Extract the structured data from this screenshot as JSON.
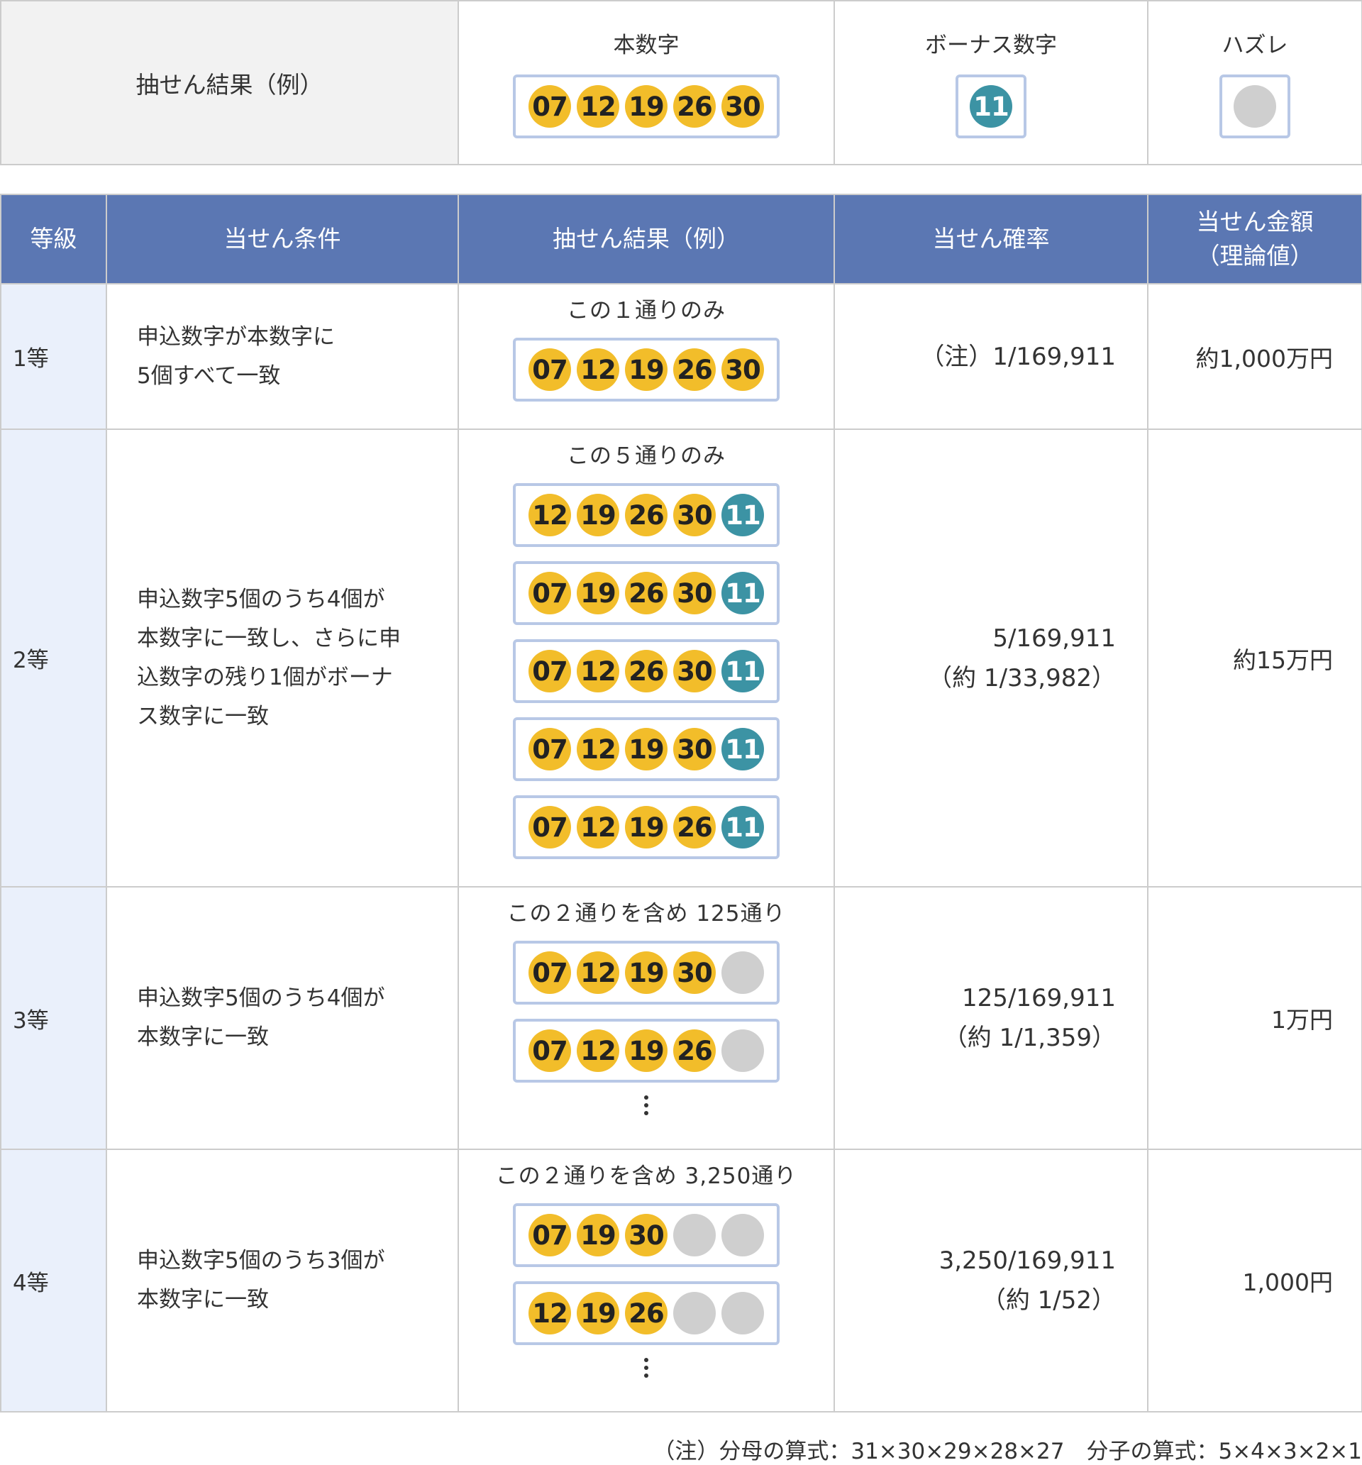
{
  "legend": {
    "label": "抽せん結果（例）",
    "main_head": "本数字",
    "main_balls": [
      "07",
      "12",
      "19",
      "26",
      "30"
    ],
    "bonus_head": "ボーナス数字",
    "bonus_ball": "11",
    "miss_head": "ハズレ"
  },
  "table": {
    "headers": {
      "grade": "等級",
      "condition": "当せん条件",
      "result": "抽せん結果（例）",
      "probability": "当せん確率",
      "amount_line1": "当せん金額",
      "amount_line2": "（理論値）"
    },
    "rows": [
      {
        "grade": "1等",
        "condition_lines": [
          "申込数字が本数字に",
          "5個すべて一致"
        ],
        "note": "この１通りのみ",
        "combos": [
          [
            "07",
            "12",
            "19",
            "26",
            "30"
          ]
        ],
        "prob_line1": "（注）1/169,911",
        "prob_line2": "",
        "amount": "約1,000万円"
      },
      {
        "grade": "2等",
        "condition_lines": [
          "申込数字5個のうち4個が",
          "本数字に一致し、さらに申",
          "込数字の残り1個がボーナ",
          "ス数字に一致"
        ],
        "note": "この５通りのみ",
        "combos": [
          [
            "12",
            "19",
            "26",
            "30",
            "11"
          ],
          [
            "07",
            "19",
            "26",
            "30",
            "11"
          ],
          [
            "07",
            "12",
            "26",
            "30",
            "11"
          ],
          [
            "07",
            "12",
            "19",
            "30",
            "11"
          ],
          [
            "07",
            "12",
            "19",
            "26",
            "11"
          ]
        ],
        "prob_line1": "5/169,911",
        "prob_line2": "（約 1/33,982）",
        "amount": "約15万円"
      },
      {
        "grade": "3等",
        "condition_lines": [
          "申込数字5個のうち4個が",
          "本数字に一致"
        ],
        "note": "この２通りを含め 125通り",
        "combos": [
          [
            "07",
            "12",
            "19",
            "30",
            ""
          ],
          [
            "07",
            "12",
            "19",
            "26",
            ""
          ]
        ],
        "prob_line1": "125/169,911",
        "prob_line2": "（約 1/1,359）",
        "amount": "1万円"
      },
      {
        "grade": "4等",
        "condition_lines": [
          "申込数字5個のうち3個が",
          "本数字に一致"
        ],
        "note": "この２通りを含め 3,250通り",
        "combos": [
          [
            "07",
            "19",
            "30",
            "",
            ""
          ],
          [
            "12",
            "19",
            "26",
            "",
            ""
          ]
        ],
        "prob_line1": "3,250/169,911",
        "prob_line2": "（約 1/52）",
        "amount": "1,000円"
      }
    ]
  },
  "footnote": "（注）分母の算式：31×30×29×28×27　分子の算式：5×4×3×2×1",
  "colors": {
    "header_bg": "#5b77b3",
    "grade_bg": "#eaf0fb",
    "main_ball": "#f2bd2a",
    "bonus_ball": "#3c93a4",
    "miss_ball": "#cfcfcf",
    "box_border": "#b8c8e6"
  }
}
